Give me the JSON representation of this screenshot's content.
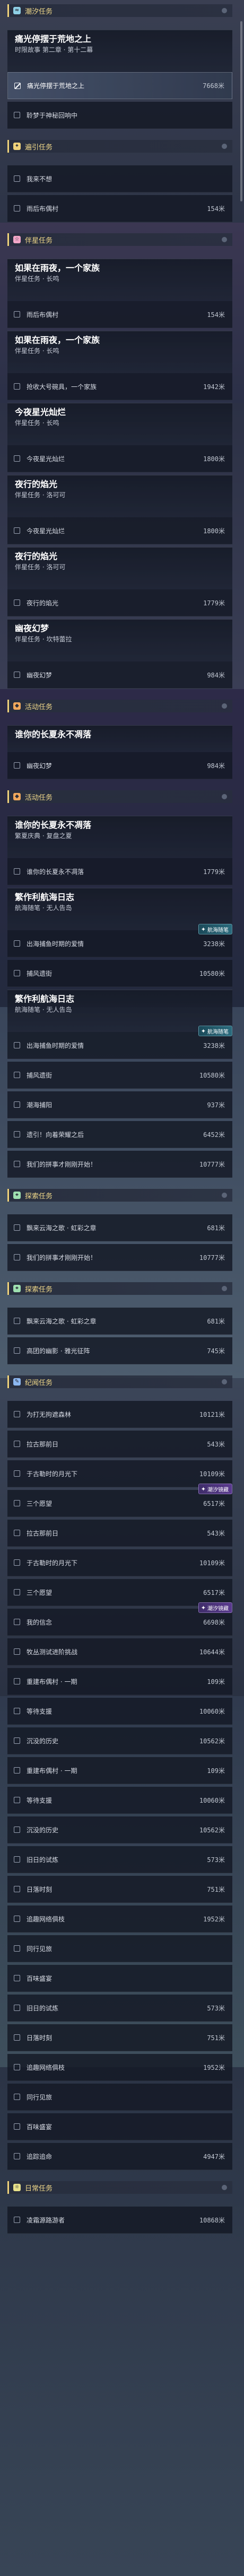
{
  "colors": {
    "accent_gold": "#efd27a",
    "card_bg": "#161b28",
    "row_bg": "#131824",
    "selected_row_bg": "#445068",
    "badge_purple": "#5a3a8e",
    "badge_teal": "#2b6b7d"
  },
  "section_icons": {
    "潮汐任务": {
      "glyph": "≈",
      "color": "#8fd0e6",
      "name": "tide-quest-icon"
    },
    "遍引任务": {
      "glyph": "✦",
      "color": "#efd27a",
      "name": "guide-quest-icon"
    },
    "伴星任务": {
      "glyph": "☆",
      "color": "#f2a6c8",
      "name": "companion-quest-icon"
    },
    "活动任务": {
      "glyph": "◆",
      "color": "#f0a85c",
      "name": "event-quest-icon"
    },
    "探索任务": {
      "glyph": "⌖",
      "color": "#9ee0b0",
      "name": "exploration-quest-icon"
    },
    "纪闻任务": {
      "glyph": "✎",
      "color": "#8cb7f0",
      "name": "lore-quest-icon"
    },
    "日常任务": {
      "glyph": "☼",
      "color": "#e8e18a",
      "name": "daily-quest-icon"
    }
  },
  "items": [
    {
      "t": "section",
      "label": "潮汐任务"
    },
    {
      "t": "card",
      "title": "痛光停摆于荒地之上",
      "sub": "时限故事 第二章 · 第十二幕"
    },
    {
      "t": "row",
      "text": "痛光停摆于荒地之上",
      "meta": "7668米",
      "sel": true,
      "on": true
    },
    {
      "t": "row",
      "text": "聆梦于神秘回响中",
      "meta": ""
    },
    {
      "t": "section",
      "label": "遍引任务"
    },
    {
      "t": "row",
      "text": "我来不想",
      "meta": ""
    },
    {
      "t": "row",
      "text": "雨后布偶村",
      "meta": "154米"
    },
    {
      "t": "section",
      "label": "伴星任务"
    },
    {
      "t": "card",
      "title": "如果在雨夜，一个家族",
      "sub": "伴星任务 · 长鸣"
    },
    {
      "t": "row",
      "text": "雨后布偶村",
      "meta": "154米"
    },
    {
      "t": "card",
      "title": "如果在雨夜，一个家族",
      "sub": "伴星任务 · 长鸣"
    },
    {
      "t": "row",
      "text": "抢收大号碗具，一个家族",
      "meta": "1942米"
    },
    {
      "t": "card",
      "title": "今夜星光灿烂",
      "sub": "伴星任务 · 长鸣"
    },
    {
      "t": "row",
      "text": "今夜星光灿烂",
      "meta": "1800米"
    },
    {
      "t": "card",
      "title": "夜行的焰光",
      "sub": "伴星任务 · 洛可可"
    },
    {
      "t": "row",
      "text": "今夜星光灿烂",
      "meta": "1800米"
    },
    {
      "t": "card",
      "title": "夜行的焰光",
      "sub": "伴星任务 · 洛可可"
    },
    {
      "t": "row",
      "text": "夜行的焰光",
      "meta": "1779米"
    },
    {
      "t": "card",
      "title": "幽夜幻梦",
      "sub": "伴星任务 · 坎特蕾拉"
    },
    {
      "t": "row",
      "text": "幽夜幻梦",
      "meta": "984米"
    },
    {
      "t": "section",
      "label": "活动任务"
    },
    {
      "t": "card",
      "title": "谁你的长夏永不凋落",
      "sub": ""
    },
    {
      "t": "row",
      "text": "幽夜幻梦",
      "meta": "984米"
    },
    {
      "t": "section",
      "label": "活动任务"
    },
    {
      "t": "card",
      "title": "谁你的长夏永不凋落",
      "sub": "繁夏庆典 · 复盘之夏"
    },
    {
      "t": "row",
      "text": "谁你的长夏永不凋落",
      "meta": "1779米"
    },
    {
      "t": "card",
      "title": "繁作利航海日志",
      "sub": "航海随笔 · 无人告岛"
    },
    {
      "t": "row",
      "text": "出海捕鱼时期的爱情",
      "meta": "3238米",
      "badge": {
        "text": "航海随笔",
        "kind": "teal"
      }
    },
    {
      "t": "row",
      "text": "捕风遗街",
      "meta": "10580米"
    },
    {
      "t": "card",
      "title": "繁作利航海日志",
      "sub": "航海随笔 · 无人告岛"
    },
    {
      "t": "row",
      "text": "出海捕鱼时期的爱情",
      "meta": "3238米",
      "badge": {
        "text": "航海随笔",
        "kind": "teal"
      }
    },
    {
      "t": "row",
      "text": "捕风遗街",
      "meta": "10580米"
    },
    {
      "t": "row",
      "text": "潮海捕阳",
      "meta": "937米"
    },
    {
      "t": "row",
      "text": "遗引！向着荣耀之后",
      "meta": "6452米"
    },
    {
      "t": "row",
      "text": "我们的拼事才刚刚开始！",
      "meta": "10777米"
    },
    {
      "t": "section",
      "label": "探索任务"
    },
    {
      "t": "row",
      "text": "飘来云海之歌 · 虹彩之章",
      "meta": "681米"
    },
    {
      "t": "row",
      "text": "我们的拼事才刚刚开始！",
      "meta": "10777米"
    },
    {
      "t": "section",
      "label": "探索任务"
    },
    {
      "t": "row",
      "text": "飘来云海之歌 · 虹彩之章",
      "meta": "681米"
    },
    {
      "t": "row",
      "text": "高团的幽影 · 雅光征阵",
      "meta": "745米"
    },
    {
      "t": "section",
      "label": "纪闻任务"
    },
    {
      "t": "row",
      "text": "为打无拘遮森林",
      "meta": "10121米"
    },
    {
      "t": "row",
      "text": "拉古那前日",
      "meta": "543米"
    },
    {
      "t": "row",
      "text": "于古勒时的月光下",
      "meta": "10109米"
    },
    {
      "t": "row",
      "text": "三个愿望",
      "meta": "6517米",
      "badge": {
        "text": "潮汐镜藏",
        "kind": "purple"
      }
    },
    {
      "t": "row",
      "text": "拉古那前日",
      "meta": "543米"
    },
    {
      "t": "row",
      "text": "于古勒时的月光下",
      "meta": "10109米"
    },
    {
      "t": "row",
      "text": "三个愿望",
      "meta": "6517米"
    },
    {
      "t": "row",
      "text": "我的信念",
      "meta": "6698米",
      "badge": {
        "text": "潮汐镜藏",
        "kind": "purple"
      }
    },
    {
      "t": "row",
      "text": "牧丛测试进阶挑战",
      "meta": "10644米"
    },
    {
      "t": "row",
      "text": "重建布偶村 · 一期",
      "meta": "109米"
    },
    {
      "t": "row",
      "text": "等待支援",
      "meta": "10060米"
    },
    {
      "t": "row",
      "text": "沉没的历史",
      "meta": "10562米"
    },
    {
      "t": "row",
      "text": "重建布偶村 · 一期",
      "meta": "109米"
    },
    {
      "t": "row",
      "text": "等待支援",
      "meta": "10060米"
    },
    {
      "t": "row",
      "text": "沉没的历史",
      "meta": "10562米"
    },
    {
      "t": "row",
      "text": "旧日的试炼",
      "meta": "573米"
    },
    {
      "t": "row",
      "text": "日落时刻",
      "meta": "751米"
    },
    {
      "t": "row",
      "text": "追趣网络俱枝",
      "meta": "1952米"
    },
    {
      "t": "row",
      "text": "同行见旅",
      "meta": ""
    },
    {
      "t": "row",
      "text": "百味盛宴",
      "meta": ""
    },
    {
      "t": "row",
      "text": "旧日的试炼",
      "meta": "573米"
    },
    {
      "t": "row",
      "text": "日落时刻",
      "meta": "751米"
    },
    {
      "t": "row",
      "text": "追趣网络俱枝",
      "meta": "1952米"
    },
    {
      "t": "row",
      "text": "同行见旅",
      "meta": ""
    },
    {
      "t": "row",
      "text": "百味盛宴",
      "meta": ""
    },
    {
      "t": "row",
      "text": "追踪追命",
      "meta": "4947米"
    },
    {
      "t": "section",
      "label": "日常任务"
    },
    {
      "t": "row",
      "text": "凌霜源路游者",
      "meta": "10868米"
    }
  ]
}
